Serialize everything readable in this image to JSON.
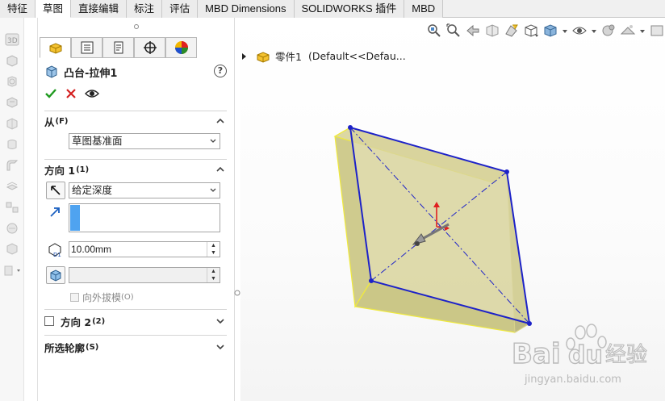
{
  "tabs": [
    {
      "label": "特征",
      "active": false
    },
    {
      "label": "草图",
      "active": true
    },
    {
      "label": "直接编辑",
      "active": false
    },
    {
      "label": "标注",
      "active": false
    },
    {
      "label": "评估",
      "active": false
    },
    {
      "label": "MBD Dimensions",
      "active": false
    },
    {
      "label": "SOLIDWORKS 插件",
      "active": false
    },
    {
      "label": "MBD",
      "active": false
    }
  ],
  "left_strip": {
    "icons": [
      "3d-sketch-icon",
      "extrude-icon",
      "revolve-icon",
      "sweep-icon",
      "loft-icon",
      "boundary-icon",
      "fillet-icon",
      "rib-icon",
      "pattern-icon",
      "wrap-icon",
      "reference-geometry-icon"
    ]
  },
  "property_manager": {
    "tab_icons": [
      "feature-manager-icon",
      "property-manager-icon",
      "configuration-manager-icon",
      "dimxpert-manager-icon",
      "display-manager-icon"
    ],
    "title": "凸台-拉伸1",
    "help_label": "?",
    "from": {
      "header": "从",
      "shortcut": "(F)",
      "value": "草图基准面"
    },
    "direction1": {
      "header": "方向 1",
      "shortcut": "(1)",
      "end_condition": "给定深度",
      "depth": "10.00mm",
      "draft_label": "向外拔模",
      "draft_shortcut": "(O)"
    },
    "direction2": {
      "header": "方向 2",
      "shortcut": "(2)",
      "checked": false
    },
    "contours": {
      "header": "所选轮廓",
      "shortcut": "(S)"
    }
  },
  "viewport": {
    "tree": {
      "part_name": "零件1",
      "config": "(Default<<Defau..."
    },
    "toolbar_icons": [
      "zoom-to-fit-icon",
      "zoom-to-area-icon",
      "previous-view-icon",
      "section-view-icon",
      "dynamic-annotation-icon",
      "view-orientation-icon",
      "display-style-icon",
      "hide-show-items-icon",
      "edit-appearance-icon",
      "apply-scene-icon",
      "view-settings-icon"
    ]
  },
  "watermark": {
    "brand": "Bai",
    "brand2": "经验",
    "url": "jingyan.baidu.com"
  },
  "colors": {
    "face": "#d7d39b",
    "face_edge": "#f0ea3c",
    "sketch": "#1d22c8",
    "triad_red": "#e02020"
  }
}
